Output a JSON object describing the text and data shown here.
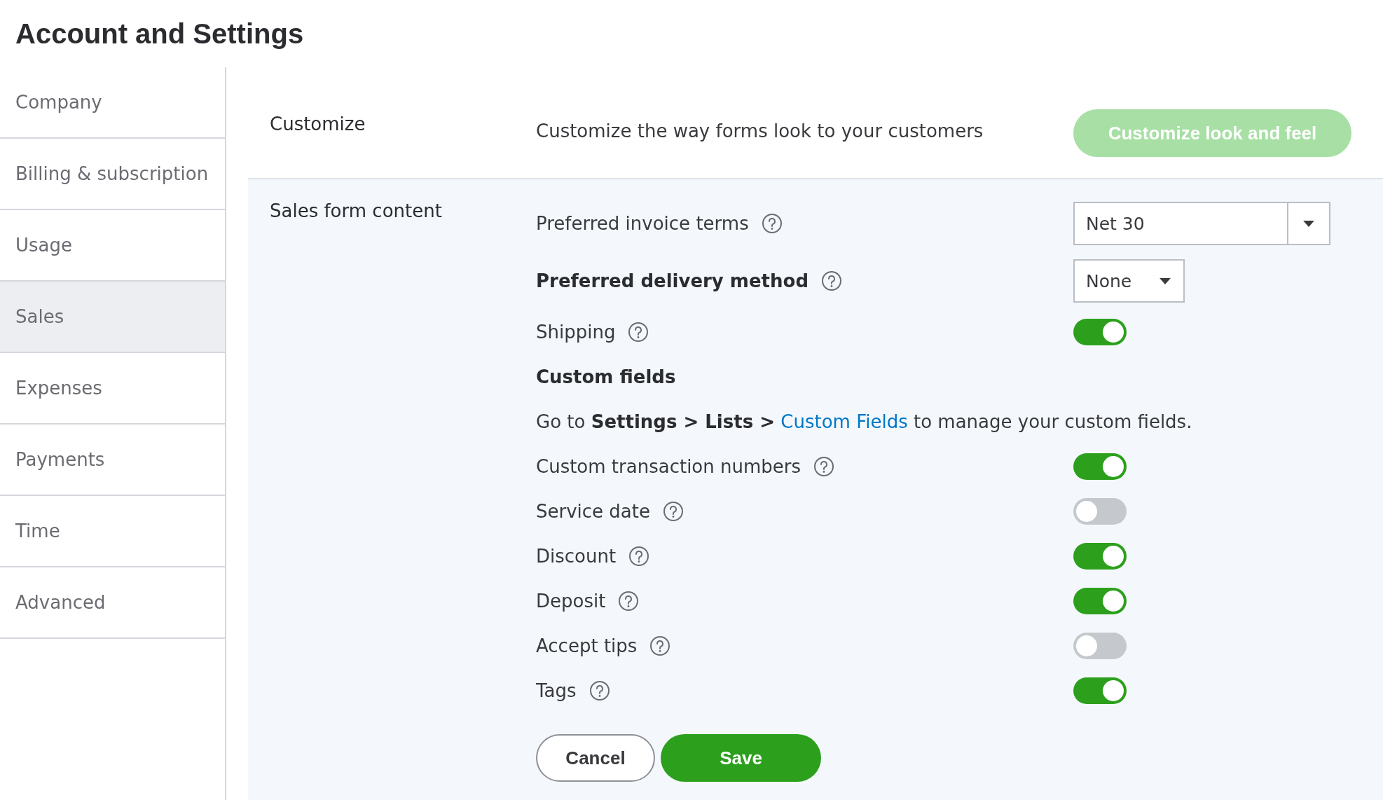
{
  "page_title": "Account and Settings",
  "sidebar": {
    "items": [
      {
        "label": "Company",
        "selected": false
      },
      {
        "label": "Billing & subscription",
        "selected": false
      },
      {
        "label": "Usage",
        "selected": false
      },
      {
        "label": "Sales",
        "selected": true
      },
      {
        "label": "Expenses",
        "selected": false
      },
      {
        "label": "Payments",
        "selected": false
      },
      {
        "label": "Time",
        "selected": false
      },
      {
        "label": "Advanced",
        "selected": false
      }
    ]
  },
  "customize": {
    "label": "Customize",
    "description": "Customize the way forms look to your customers",
    "button": "Customize look and feel"
  },
  "sales_form_content": {
    "label": "Sales form content",
    "rows": [
      {
        "kind": "select",
        "label": "Preferred invoice terms",
        "bold": false,
        "value": "Net 30"
      },
      {
        "kind": "select",
        "label": "Preferred delivery method",
        "bold": true,
        "value": "None"
      },
      {
        "kind": "toggle",
        "label": "Shipping",
        "on": true
      },
      {
        "kind": "heading",
        "label": "Custom fields"
      },
      {
        "kind": "text",
        "before": "Go to **Settings > Lists >** ",
        "link": "Custom Fields",
        "after": " to manage your custom fields."
      },
      {
        "kind": "toggle",
        "label": "Custom transaction numbers",
        "on": true
      },
      {
        "kind": "toggle",
        "label": "Service date",
        "on": false
      },
      {
        "kind": "toggle",
        "label": "Discount",
        "on": true
      },
      {
        "kind": "toggle",
        "label": "Deposit",
        "on": true
      },
      {
        "kind": "toggle",
        "label": "Accept tips",
        "on": false
      },
      {
        "kind": "toggle",
        "label": "Tags",
        "on": true
      }
    ]
  },
  "buttons": {
    "cancel": "Cancel",
    "save": "Save"
  }
}
